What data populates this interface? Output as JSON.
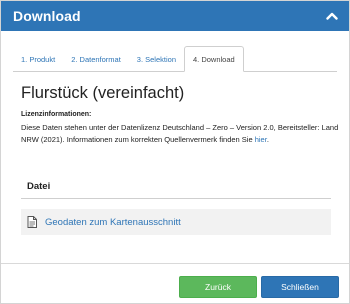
{
  "dialog": {
    "title": "Download"
  },
  "tabs": [
    {
      "label": "1. Produkt"
    },
    {
      "label": "2. Datenformat"
    },
    {
      "label": "3. Selektion"
    },
    {
      "label": "4. Download"
    }
  ],
  "content": {
    "heading": "Flurstück (vereinfacht)",
    "license_title": "Lizenzinformationen:",
    "license_text": "Diese Daten stehen unter der Datenlizenz Deutschland – Zero – Version 2.0, Bereitsteller: Land NRW (2021). Informationen zum korrekten Quellenvermerk finden Sie ",
    "license_link": "hier",
    "license_end": "."
  },
  "files": {
    "column_header": "Datei",
    "items": [
      {
        "label": "Geodaten zum Kartenausschnitt",
        "icon": "document-icon"
      }
    ]
  },
  "footer": {
    "back_label": "Zurück",
    "close_label": "Schließen"
  },
  "colors": {
    "primary": "#2e75b6",
    "success": "#5cb85c"
  }
}
